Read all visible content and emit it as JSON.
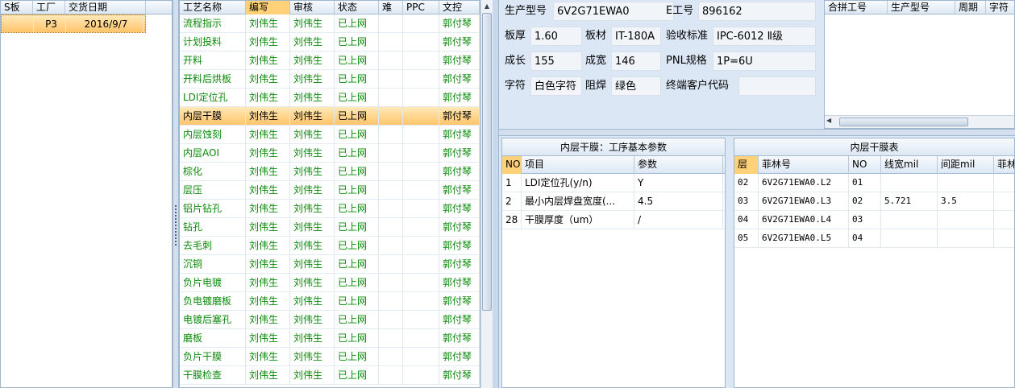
{
  "left_table": {
    "headers": [
      "S板",
      "工厂",
      "交货日期"
    ],
    "rows": [
      {
        "board": "",
        "factory": "P3",
        "date": "2016/9/7"
      }
    ]
  },
  "process_table": {
    "headers": [
      "工艺名称",
      "编写",
      "审核",
      "状态",
      "难",
      "PPC",
      "文控"
    ],
    "rows": [
      {
        "name": "流程指示",
        "writer": "刘伟生",
        "reviewer": "刘伟生",
        "status": "已上网",
        "diff": "",
        "ppc": "",
        "doc": "郭付琴"
      },
      {
        "name": "计划投料",
        "writer": "刘伟生",
        "reviewer": "刘伟生",
        "status": "已上网",
        "diff": "",
        "ppc": "",
        "doc": "郭付琴"
      },
      {
        "name": "开料",
        "writer": "刘伟生",
        "reviewer": "刘伟生",
        "status": "已上网",
        "diff": "",
        "ppc": "",
        "doc": "郭付琴"
      },
      {
        "name": "开料后烘板",
        "writer": "刘伟生",
        "reviewer": "刘伟生",
        "status": "已上网",
        "diff": "",
        "ppc": "",
        "doc": "郭付琴"
      },
      {
        "name": "LDI定位孔",
        "writer": "刘伟生",
        "reviewer": "刘伟生",
        "status": "已上网",
        "diff": "",
        "ppc": "",
        "doc": "郭付琴"
      },
      {
        "name": "内层干膜",
        "writer": "刘伟生",
        "reviewer": "刘伟生",
        "status": "已上网",
        "diff": "",
        "ppc": "",
        "doc": "郭付琴"
      },
      {
        "name": "内层蚀刻",
        "writer": "刘伟生",
        "reviewer": "刘伟生",
        "status": "已上网",
        "diff": "",
        "ppc": "",
        "doc": "郭付琴"
      },
      {
        "name": "内层AOI",
        "writer": "刘伟生",
        "reviewer": "刘伟生",
        "status": "已上网",
        "diff": "",
        "ppc": "",
        "doc": "郭付琴"
      },
      {
        "name": "棕化",
        "writer": "刘伟生",
        "reviewer": "刘伟生",
        "status": "已上网",
        "diff": "",
        "ppc": "",
        "doc": "郭付琴"
      },
      {
        "name": "层压",
        "writer": "刘伟生",
        "reviewer": "刘伟生",
        "status": "已上网",
        "diff": "",
        "ppc": "",
        "doc": "郭付琴"
      },
      {
        "name": "铝片钻孔",
        "writer": "刘伟生",
        "reviewer": "刘伟生",
        "status": "已上网",
        "diff": "",
        "ppc": "",
        "doc": "郭付琴"
      },
      {
        "name": "钻孔",
        "writer": "刘伟生",
        "reviewer": "刘伟生",
        "status": "已上网",
        "diff": "",
        "ppc": "",
        "doc": "郭付琴"
      },
      {
        "name": "去毛刺",
        "writer": "刘伟生",
        "reviewer": "刘伟生",
        "status": "已上网",
        "diff": "",
        "ppc": "",
        "doc": "郭付琴"
      },
      {
        "name": "沉铜",
        "writer": "刘伟生",
        "reviewer": "刘伟生",
        "status": "已上网",
        "diff": "",
        "ppc": "",
        "doc": "郭付琴"
      },
      {
        "name": "负片电镀",
        "writer": "刘伟生",
        "reviewer": "刘伟生",
        "status": "已上网",
        "diff": "",
        "ppc": "",
        "doc": "郭付琴"
      },
      {
        "name": "负电镀磨板",
        "writer": "刘伟生",
        "reviewer": "刘伟生",
        "status": "已上网",
        "diff": "",
        "ppc": "",
        "doc": "郭付琴"
      },
      {
        "name": "电镀后塞孔",
        "writer": "刘伟生",
        "reviewer": "刘伟生",
        "status": "已上网",
        "diff": "",
        "ppc": "",
        "doc": "郭付琴"
      },
      {
        "name": "磨板",
        "writer": "刘伟生",
        "reviewer": "刘伟生",
        "status": "已上网",
        "diff": "",
        "ppc": "",
        "doc": "郭付琴"
      },
      {
        "name": "负片干膜",
        "writer": "刘伟生",
        "reviewer": "刘伟生",
        "status": "已上网",
        "diff": "",
        "ppc": "",
        "doc": "郭付琴"
      },
      {
        "name": "干膜检查",
        "writer": "刘伟生",
        "reviewer": "刘伟生",
        "status": "已上网",
        "diff": "",
        "ppc": "",
        "doc": "郭付琴"
      }
    ]
  },
  "info": {
    "model_label": "生产型号",
    "model_value": "6V2G71EWA0",
    "eno_label": "E工号",
    "eno_value": "896162",
    "thickness_label": "板厚",
    "thickness_value": "1.60",
    "material_label": "板材",
    "material_value": "IT-180A",
    "standard_label": "验收标准",
    "standard_value": "IPC-6012 Ⅱ级",
    "growth_label": "成长",
    "growth_value": "155",
    "width_label": "成宽",
    "width_value": "146",
    "pnl_label": "PNL规格",
    "pnl_value": "1P=6U",
    "char_label": "字符",
    "char_value": "白色字符",
    "mask_label": "阻焊",
    "mask_value": "绿色",
    "customer_label": "终端客户代码",
    "customer_value": ""
  },
  "merge_table": {
    "headers": [
      "合拼工号",
      "生产型号",
      "周期",
      "字符"
    ]
  },
  "params_panel": {
    "title": "内层干膜：工序基本参数",
    "headers": [
      "NO",
      "项目",
      "参数"
    ],
    "rows": [
      {
        "no": "1",
        "item": "LDI定位孔(y/n)",
        "param": "Y"
      },
      {
        "no": "2",
        "item": "最小内层焊盘宽度(...",
        "param": "4.5"
      },
      {
        "no": "28",
        "item": "干膜厚度（um）",
        "param": "/"
      }
    ]
  },
  "film_panel": {
    "title": "内层干膜表",
    "headers": [
      "层",
      "菲林号",
      "NO",
      "线宽mil",
      "间距mil",
      "菲林"
    ],
    "rows": [
      {
        "layer": "02",
        "film": "6V2G71EWA0.L2",
        "no": "01",
        "lw": "",
        "sp": "",
        "extra": ""
      },
      {
        "layer": "03",
        "film": "6V2G71EWA0.L3",
        "no": "02",
        "lw": "5.721",
        "sp": "3.5",
        "extra": ""
      },
      {
        "layer": "04",
        "film": "6V2G71EWA0.L4",
        "no": "03",
        "lw": "",
        "sp": "",
        "extra": ""
      },
      {
        "layer": "05",
        "film": "6V2G71EWA0.L5",
        "no": "04",
        "lw": "",
        "sp": "",
        "extra": ""
      }
    ]
  },
  "selected_process_index": 5,
  "colors": {
    "green_text": "#0a8a0a",
    "selection": "#ffc46a",
    "header_highlight": "#ffd27a"
  }
}
